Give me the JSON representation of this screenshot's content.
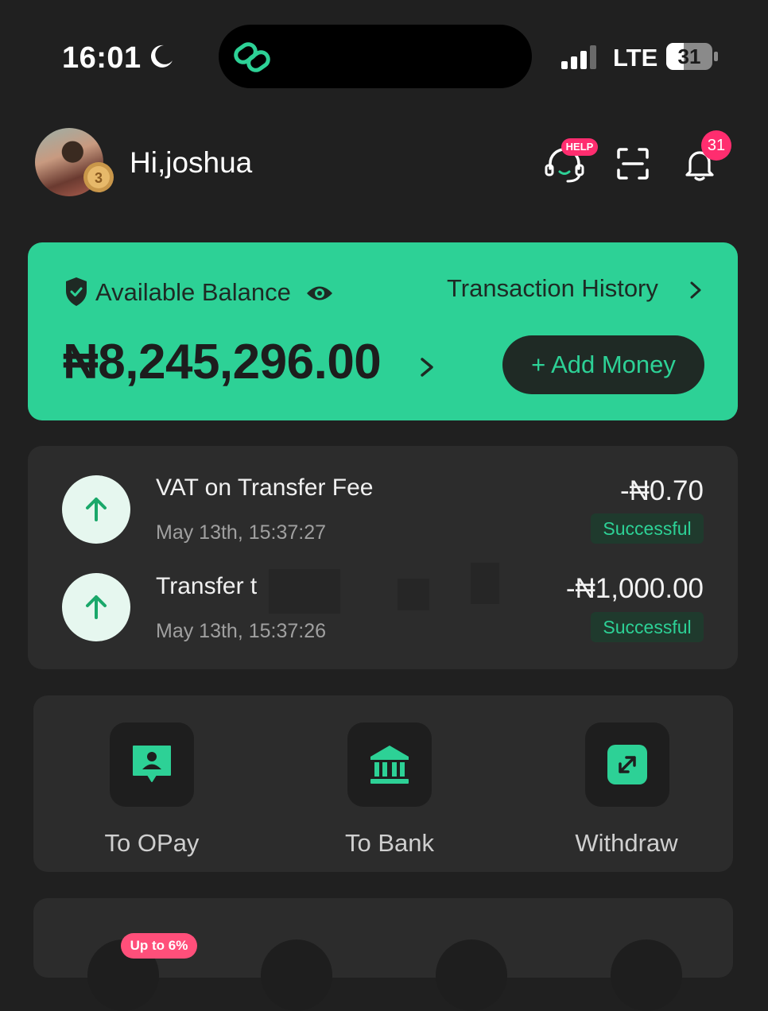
{
  "status_bar": {
    "time": "16:01",
    "network": "LTE",
    "battery": "31"
  },
  "header": {
    "greeting": "Hi,joshua",
    "medal_level": "3",
    "help_badge": "HELP",
    "notification_count": "31"
  },
  "balance": {
    "label": "Available Balance",
    "amount": "₦8,245,296.00",
    "history_link": "Transaction History",
    "add_money": "+ Add Money"
  },
  "transactions": [
    {
      "title": "VAT on Transfer Fee",
      "date": "May 13th, 15:37:27",
      "amount": "-₦0.70",
      "status": "Successful"
    },
    {
      "title": "Transfer t",
      "date": "May 13th, 15:37:26",
      "amount": "-₦1,000.00",
      "status": "Successful"
    }
  ],
  "actions": [
    {
      "label": "To OPay",
      "icon": "person-chat-icon"
    },
    {
      "label": "To Bank",
      "icon": "bank-icon"
    },
    {
      "label": "Withdraw",
      "icon": "withdraw-arrows-icon"
    }
  ],
  "promo_badge": "Up to 6%",
  "colors": {
    "accent": "#2dd196",
    "background": "#202020",
    "card": "#2c2c2c",
    "badge": "#ff2d6f"
  }
}
